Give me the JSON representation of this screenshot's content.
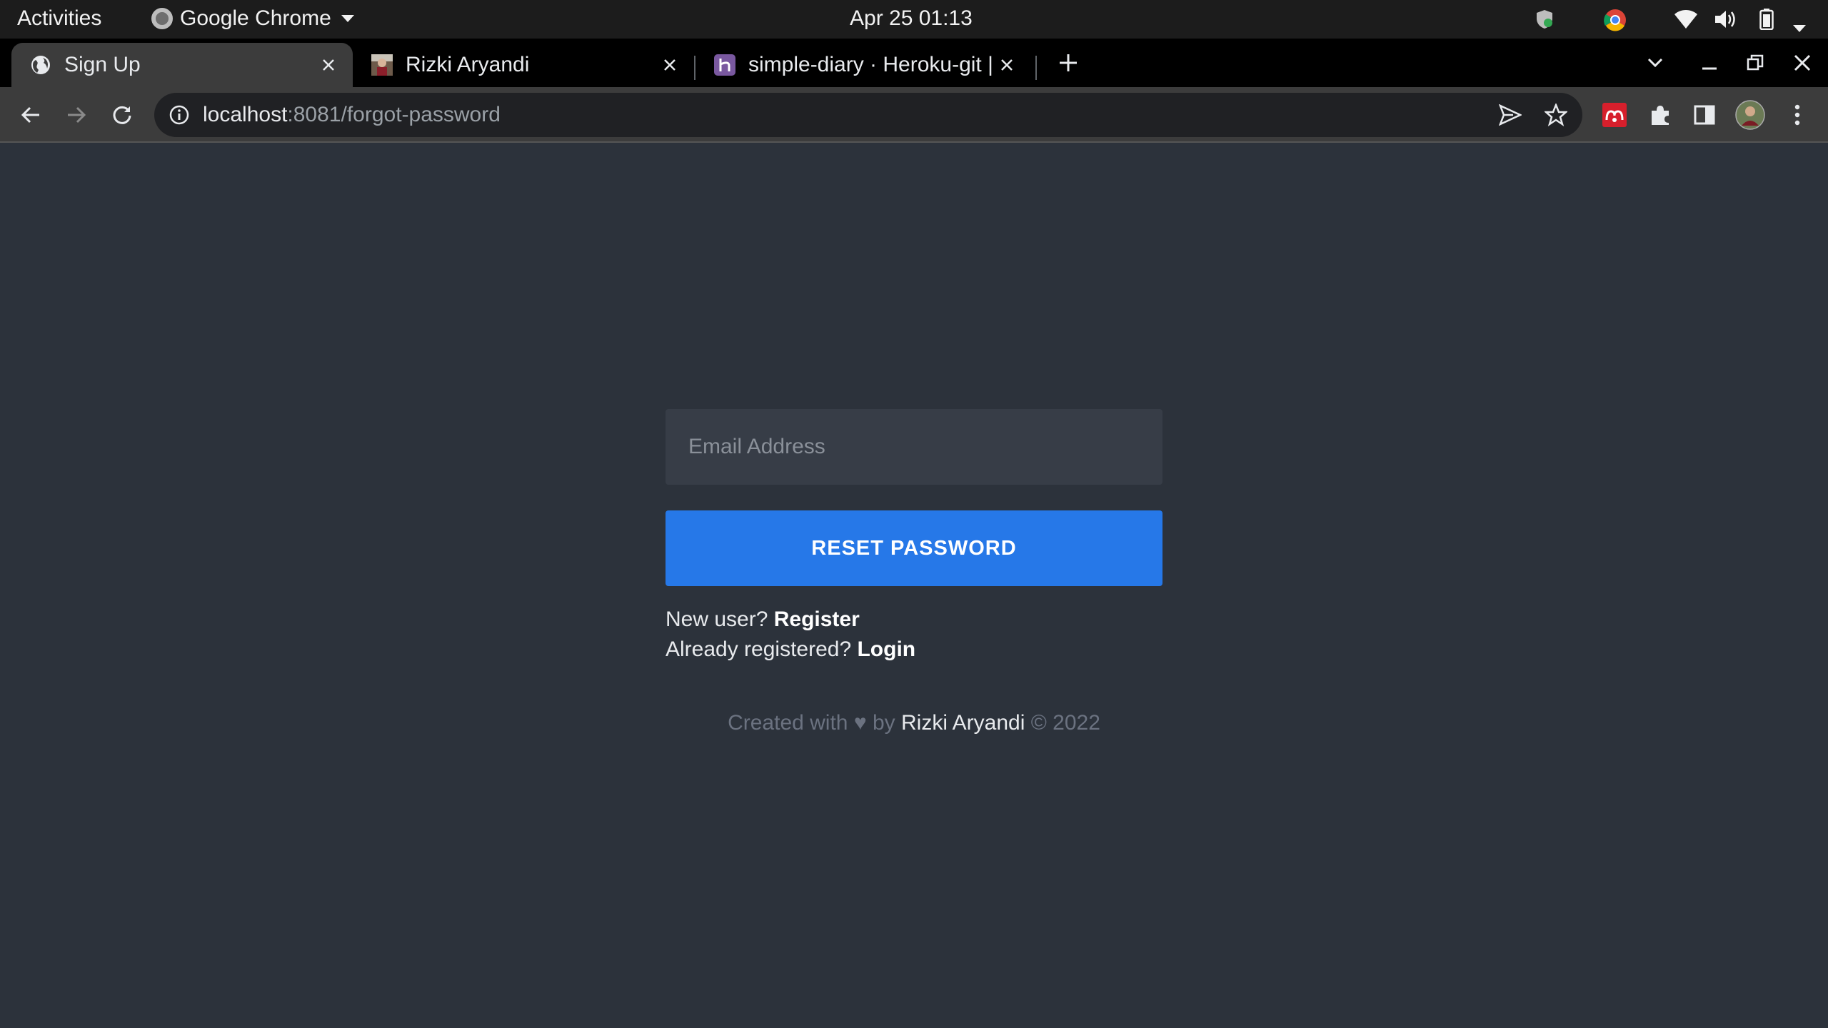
{
  "system_bar": {
    "activities": "Activities",
    "app_name": "Google Chrome",
    "datetime": "Apr 25  01:13",
    "tray_icons": [
      "shield-icon",
      "chrome-icon",
      "wifi-icon",
      "volume-icon",
      "battery-icon",
      "system-menu-caret-icon"
    ]
  },
  "tabs": [
    {
      "title": "Sign Up",
      "favicon": "globe-icon",
      "active": true
    },
    {
      "title": "Rizki Aryandi",
      "favicon": "avatar-icon",
      "active": false
    },
    {
      "title": "simple-diary · Heroku-git | Heroku",
      "favicon": "heroku-icon",
      "active": false
    }
  ],
  "address_bar": {
    "host": "localhost",
    "path": ":8081/forgot-password"
  },
  "form": {
    "email_placeholder": "Email Address",
    "submit_label": "RESET PASSWORD"
  },
  "links": {
    "new_user_text": "New user? ",
    "register_label": "Register",
    "already_text": "Already registered? ",
    "login_label": "Login"
  },
  "footer": {
    "prefix": "Created with ♥ by ",
    "author": "Rizki Aryandi",
    "suffix": " © 2022"
  },
  "colors": {
    "page_background": "#2c323b",
    "input_background": "#373d47",
    "primary_button": "#2678e8",
    "tab_strip": "#000000",
    "toolbar": "#3c3c3c"
  }
}
